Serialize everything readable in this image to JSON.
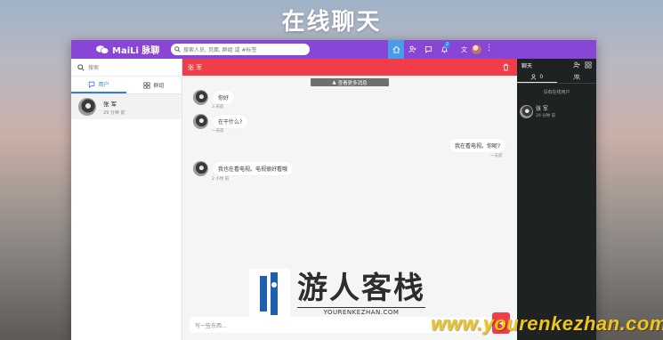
{
  "banner": {
    "title": "在线聊天"
  },
  "topnav": {
    "brand": "MaiLi 脉聊",
    "search_placeholder": "搜索人员, 页面, 群组 或 #标签",
    "notification_count": "2",
    "lang_label": "文"
  },
  "left": {
    "search_placeholder": "搜索",
    "tabs": [
      {
        "label": "用户",
        "active": true
      },
      {
        "label": "群组",
        "active": false
      }
    ],
    "contacts": [
      {
        "name": "张 军",
        "time": "29 分钟 前"
      }
    ]
  },
  "chat": {
    "title": "张 军",
    "load_more": "查看更多消息",
    "messages": [
      {
        "side": "left",
        "text": "你好",
        "time": "3 天前"
      },
      {
        "side": "left",
        "text": "在干什么?",
        "time": "一天前"
      },
      {
        "side": "right",
        "text": "我在看电视。你呢?",
        "time": "一天前"
      },
      {
        "side": "left",
        "text": "我也在看电视。电视很好看哦",
        "time": "2 小时 前"
      }
    ],
    "composer_placeholder": "写一些东西..."
  },
  "right": {
    "title": "聊天",
    "users_count": "0",
    "no_online": "没有在线用户",
    "contacts": [
      {
        "name": "张 军",
        "time": "29 分钟 前"
      }
    ]
  },
  "watermark": {
    "cn": "游人客栈",
    "en": "YOURENKEZHAN.COM",
    "url": "www.yourenkezhan.com"
  },
  "colors": {
    "topnav": "#8845d6",
    "chat_header": "#ef3d4a",
    "right_panel": "#1e2222",
    "active_tab": "#2f7de1"
  }
}
